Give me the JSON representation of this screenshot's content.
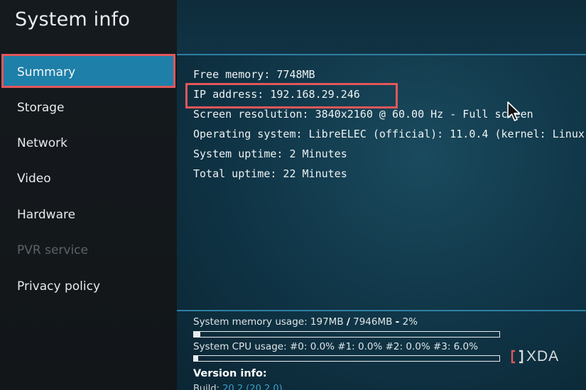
{
  "app": {
    "title": "System info"
  },
  "sidebar": {
    "items": [
      {
        "label": "Summary",
        "state": "selected"
      },
      {
        "label": "Storage",
        "state": "normal"
      },
      {
        "label": "Network",
        "state": "normal"
      },
      {
        "label": "Video",
        "state": "normal"
      },
      {
        "label": "Hardware",
        "state": "normal"
      },
      {
        "label": "PVR service",
        "state": "disabled"
      },
      {
        "label": "Privacy policy",
        "state": "normal"
      }
    ]
  },
  "summary": {
    "lines": [
      "Free memory: 7748MB",
      "IP address: 192.168.29.246",
      "Screen resolution: 3840x2160 @ 60.00 Hz - Full screen",
      "Operating system: LibreELEC (official): 11.0.4 (kernel: Linux",
      "System uptime: 2 Minutes",
      "Total uptime: 22 Minutes"
    ]
  },
  "usage": {
    "memory": {
      "prefix": "System memory usage: 197MB ",
      "sep1": "/",
      "mid": " 7946MB ",
      "sep2": "-",
      "suffix": " 2%",
      "percent": 2
    },
    "cpu": {
      "label": "System CPU usage: #0: 0.0% #1: 0.0% #2: 0.0% #3: 6.0%",
      "percent": 1.5
    }
  },
  "version": {
    "title": "Version info:",
    "build_prefix": "Build: ",
    "build_value": "20.2 (20.2.0)"
  },
  "watermark": {
    "text": "XDA",
    "icon": "xda-logo-icon"
  },
  "colors": {
    "accent": "#1e7fa8",
    "highlight_border": "#e2575a",
    "divider": "#2e7fa3"
  }
}
